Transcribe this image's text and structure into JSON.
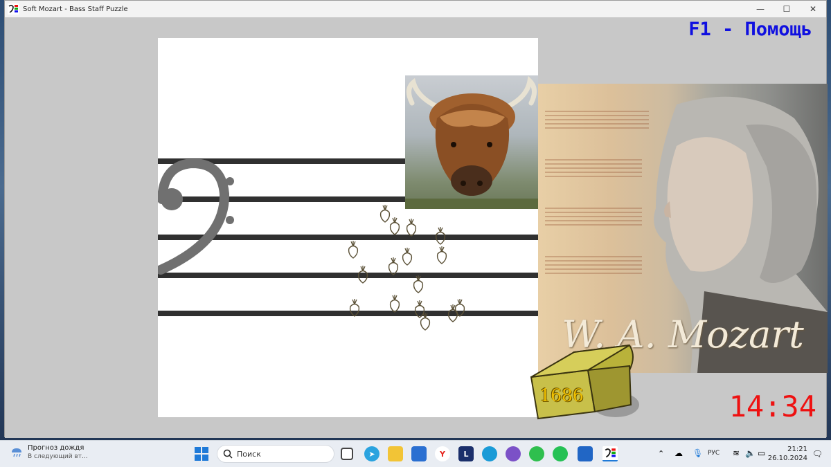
{
  "window": {
    "title": "Soft Mozart - Bass Staff Puzzle",
    "controls": {
      "minimize": "—",
      "maximize": "☐",
      "close": "✕"
    }
  },
  "game": {
    "help_hint": "F1 - Помощь",
    "timer": "14:34",
    "score": "1686",
    "signature": "W. A. Mozart",
    "colors": {
      "help": "#1010e0",
      "timer": "#ee1111",
      "score": "#f0c000",
      "staff": "#303030"
    }
  },
  "taskbar": {
    "weather_title": "Прогноз дождя",
    "weather_subtitle": "В следующий вт...",
    "search_placeholder": "Поиск",
    "apps": [
      {
        "name": "telegram-icon"
      },
      {
        "name": "file-explorer-icon"
      },
      {
        "name": "store-icon"
      },
      {
        "name": "yandex-browser-icon",
        "label": "Y"
      },
      {
        "name": "l-app-icon",
        "label": "L"
      },
      {
        "name": "edge-icon"
      },
      {
        "name": "viber-icon"
      },
      {
        "name": "wechat-icon"
      },
      {
        "name": "whatsapp-icon"
      },
      {
        "name": "app-icon"
      },
      {
        "name": "soft-mozart-icon"
      }
    ],
    "language": "РУС",
    "time": "21:21",
    "date": "26.10.2024"
  }
}
